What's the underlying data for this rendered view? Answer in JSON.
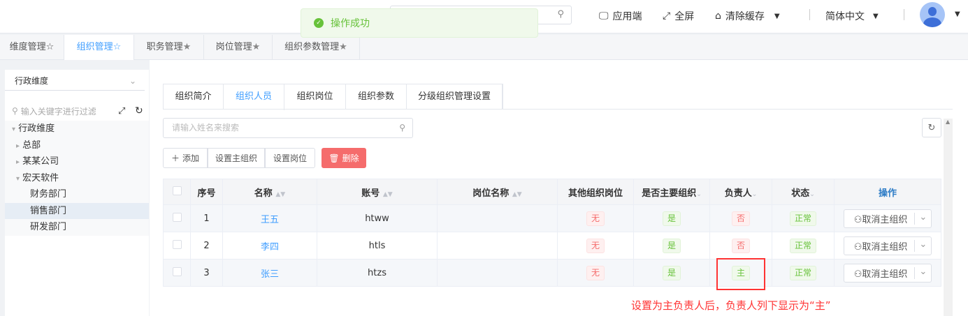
{
  "header": {
    "toast": "操作成功",
    "client": "应用端",
    "fullscreen": "全屏",
    "clear_cache": "清除缓存",
    "language": "简体中文"
  },
  "page_tabs": [
    {
      "label": "维度管理",
      "star": "☆"
    },
    {
      "label": "组织管理",
      "star": "☆"
    },
    {
      "label": "职务管理",
      "star": "★"
    },
    {
      "label": "岗位管理",
      "star": "★"
    },
    {
      "label": "组织参数管理",
      "star": "★"
    }
  ],
  "left": {
    "dimension_select": "行政维度",
    "filter_placeholder": "输入关键字进行过滤",
    "tree": [
      {
        "label": "行政维度",
        "arrow": "▾"
      },
      {
        "label": "总部",
        "arrow": "▸"
      },
      {
        "label": "某某公司",
        "arrow": "▸"
      },
      {
        "label": "宏天软件",
        "arrow": "▾"
      },
      {
        "label": "财务部门",
        "arrow": ""
      },
      {
        "label": "销售部门",
        "arrow": ""
      },
      {
        "label": "研发部门",
        "arrow": ""
      }
    ]
  },
  "inner_tabs": [
    "组织简介",
    "组织人员",
    "组织岗位",
    "组织参数",
    "分级组织管理设置"
  ],
  "search_placeholder": "请输入姓名来搜索",
  "toolbar": {
    "add": "添加",
    "set_main_org": "设置主组织",
    "set_post": "设置岗位",
    "delete": "删除"
  },
  "table": {
    "headers": [
      "序号",
      "名称",
      "账号",
      "岗位名称",
      "其他组织岗位",
      "是否主要组织",
      "负责人",
      "状态",
      "操作"
    ],
    "rows": [
      {
        "no": "1",
        "name": "王五",
        "account": "htww",
        "post": "",
        "other": "无",
        "main_org": "是",
        "leader": "否",
        "status": "正常",
        "action": "取消主组织"
      },
      {
        "no": "2",
        "name": "李四",
        "account": "htls",
        "post": "",
        "other": "无",
        "main_org": "是",
        "leader": "否",
        "status": "正常",
        "action": "取消主组织"
      },
      {
        "no": "3",
        "name": "张三",
        "account": "htzs",
        "post": "",
        "other": "无",
        "main_org": "是",
        "leader": "主",
        "status": "正常",
        "action": "取消主组织"
      }
    ]
  },
  "annotation": "设置为主负责人后，负责人列下显示为“主”"
}
